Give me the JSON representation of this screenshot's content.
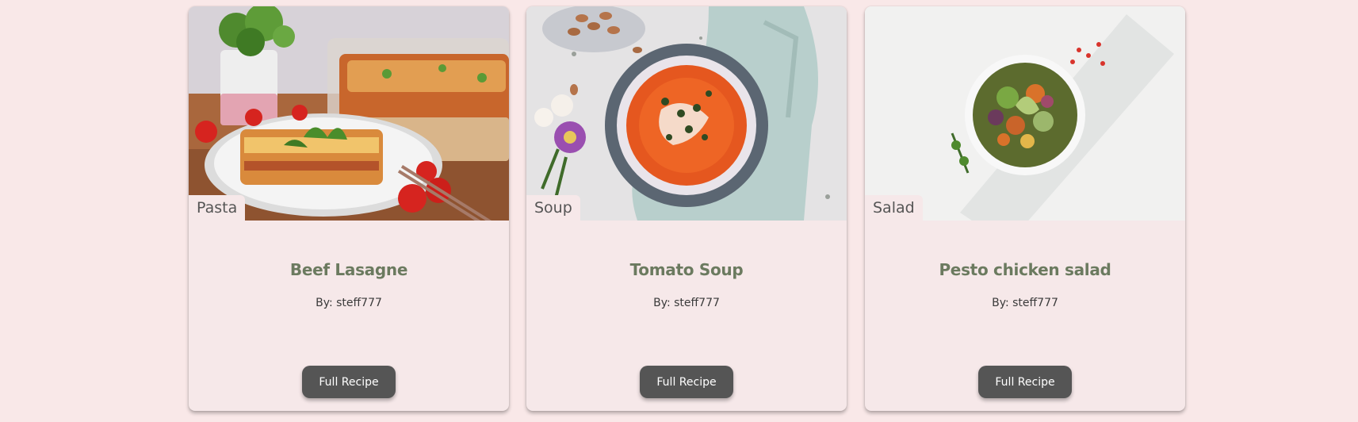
{
  "recipes": [
    {
      "category": "Pasta",
      "title": "Beef Lasagne",
      "author": "By: steff777",
      "button_label": "Full Recipe",
      "image_subject": "beef-lasagne-photo"
    },
    {
      "category": "Soup",
      "title": "Tomato Soup",
      "author": "By: steff777",
      "button_label": "Full Recipe",
      "image_subject": "tomato-soup-photo"
    },
    {
      "category": "Salad",
      "title": "Pesto chicken salad",
      "author": "By: steff777",
      "button_label": "Full Recipe",
      "image_subject": "pesto-chicken-salad-photo"
    }
  ],
  "colors": {
    "page_background": "#f9e8e8",
    "card_background": "#f6e8e9",
    "title": "#6b7a5f",
    "button": "#555555",
    "button_text": "#ffffff"
  }
}
